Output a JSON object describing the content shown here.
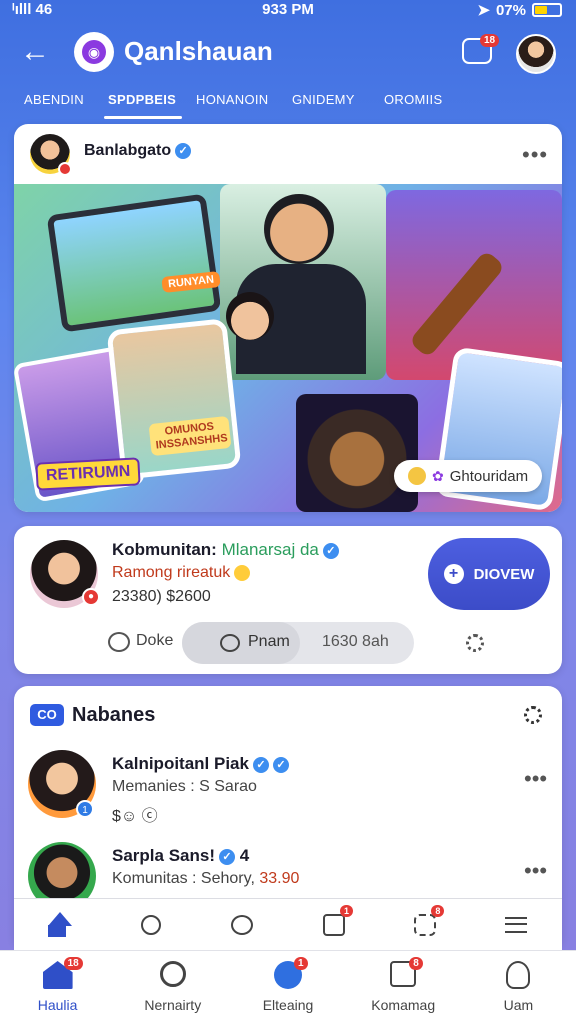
{
  "status_bar": {
    "signal": "ᴵılll 46",
    "time": "933 PM",
    "battery_text": "07%"
  },
  "header": {
    "title": "Qanlshauan",
    "notif_badge": "18"
  },
  "tabs": [
    "ABENDIN",
    "SPDPBEIS",
    "HONANOIN",
    "GNIDEMY",
    "OROMIIS"
  ],
  "post": {
    "author": "Banlabgato",
    "pill_label": "Ghtouridam",
    "collage_labels": {
      "a": "RETIRUMN",
      "b": "OMUNOS INSSANSHHS",
      "c": "RUNYAN"
    }
  },
  "profile": {
    "name": "Kobmunitan:",
    "name_handle": "Mlanarsaj da",
    "subtitle": "Ramong rireatuk",
    "stats": "23380) $2600",
    "follow_label": "DIOVEW",
    "like_label": "Doke",
    "seg_active_label": "Pnam",
    "seg_other_label": "1630 8ah"
  },
  "list": {
    "title": "Nabanes",
    "icon_label": "CO",
    "rows": [
      {
        "name": "Kalnipoitanl Piak",
        "sub": "Memanies : S Sarao",
        "price": "",
        "meta": "$☺ ⓒ",
        "badge": "1"
      },
      {
        "name": "Sarpla Sans!",
        "name_suffix": "4",
        "sub": "Komunitas : Sehory,",
        "price": "33.90",
        "meta": "$☺ ⓒ",
        "badge": ""
      }
    ]
  },
  "toolbar": {
    "badge_box": "1",
    "badge_puzzle": "8"
  },
  "bottom_nav": [
    {
      "label": "Haulia",
      "badge": "18",
      "icon": "home-icon"
    },
    {
      "label": "Nernairty",
      "badge": "",
      "icon": "search-icon"
    },
    {
      "label": "Elteaing",
      "badge": "1",
      "icon": "live-icon"
    },
    {
      "label": "Komamag",
      "badge": "8",
      "icon": "sad-face-icon"
    },
    {
      "label": "Uam",
      "badge": "",
      "icon": "user-icon"
    }
  ],
  "colors": {
    "accent": "#2f4fc8",
    "badge_red": "#e53935",
    "verify_blue": "#3d8ef0"
  }
}
